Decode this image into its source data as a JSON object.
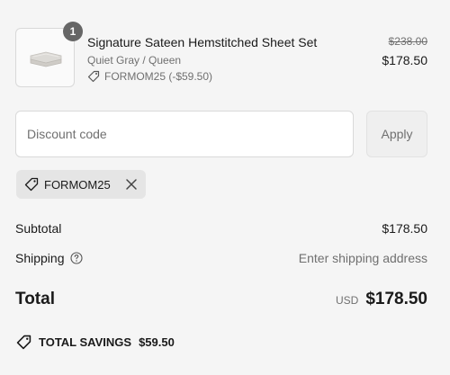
{
  "line_item": {
    "quantity": "1",
    "title": "Signature Sateen Hemstitched Sheet Set",
    "variant": "Quiet Gray / Queen",
    "discount_label": "FORMOM25 (-$59.50)",
    "original_price": "$238.00",
    "price": "$178.50",
    "thumb_icon": "folded-sheets-image"
  },
  "discount": {
    "placeholder": "Discount code",
    "apply_label": "Apply",
    "applied_code": "FORMOM25"
  },
  "summary": {
    "subtotal_label": "Subtotal",
    "subtotal_value": "$178.50",
    "shipping_label": "Shipping",
    "shipping_value": "Enter shipping address",
    "total_label": "Total",
    "currency": "USD",
    "total_value": "$178.50",
    "savings_label": "TOTAL SAVINGS",
    "savings_value": "$59.50"
  },
  "colors": {
    "background": "#f5f5f5",
    "text": "#1a1a1a",
    "muted": "#707070",
    "badge": "#666666",
    "chip": "#e5e5e5"
  }
}
